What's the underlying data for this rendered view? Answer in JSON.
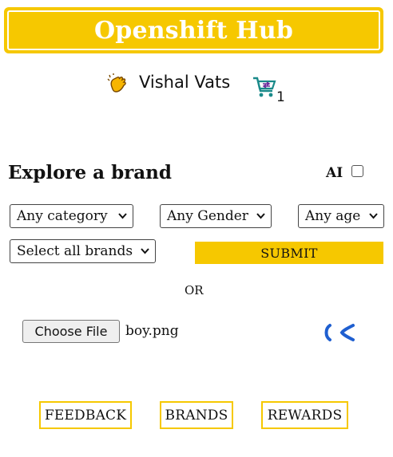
{
  "header": {
    "title": "Openshift Hub"
  },
  "user": {
    "name": "Vishal Vats",
    "wave_icon": "waving-hand-icon",
    "cart_icon": "shopping-cart-icon",
    "cart_count": "1"
  },
  "explore": {
    "title": "Explore a brand",
    "ai_label": "AI",
    "ai_checked": false
  },
  "filters": {
    "category": "Any category",
    "gender": "Any Gender",
    "age": "Any age",
    "brands": "Select all brands",
    "submit_label": "SUBMIT"
  },
  "divider": {
    "or_label": "OR"
  },
  "upload": {
    "button_label": "Choose File",
    "file_name": "boy.png",
    "loading_icon": "loading-spinner-icon"
  },
  "footer": {
    "feedback_label": "FEEDBACK",
    "brands_label": "BRANDS",
    "rewards_label": "REWARDS"
  },
  "colors": {
    "accent": "#f6c800",
    "cart": "#1a8a8a",
    "spinner": "#1f5fd0"
  }
}
